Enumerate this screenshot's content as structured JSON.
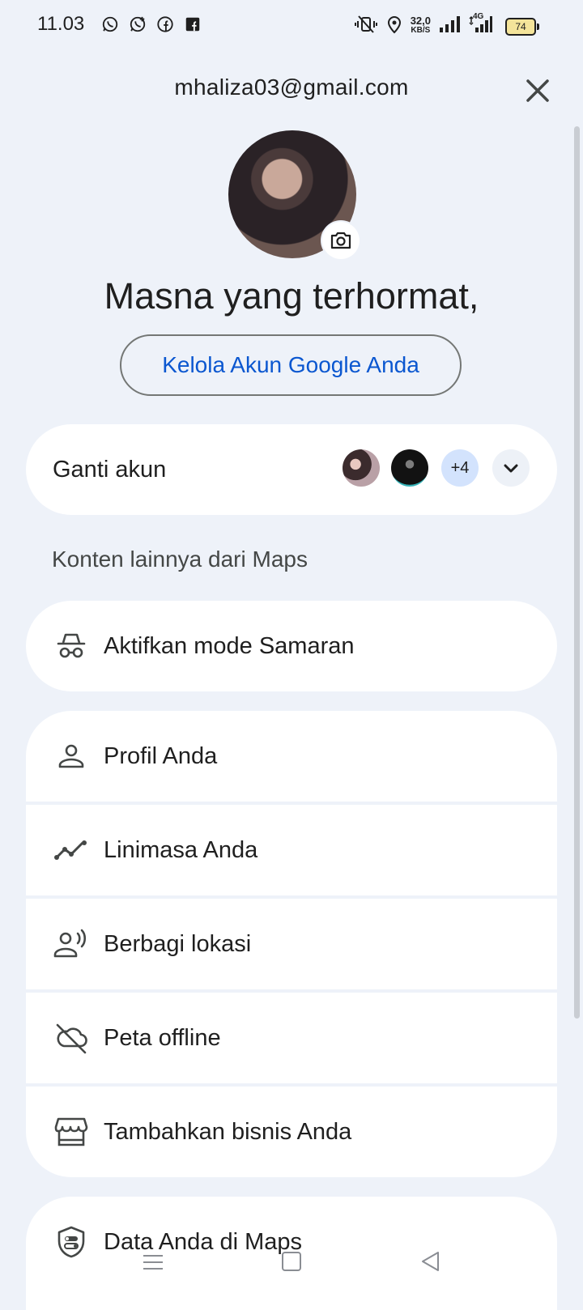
{
  "status_bar": {
    "time": "11.03",
    "speed_value": "32,0",
    "speed_unit": "KB/S",
    "network": "4G",
    "battery": "74"
  },
  "header": {
    "email": "mhaliza03@gmail.com"
  },
  "profile": {
    "greeting": "Masna yang terhormat,",
    "manage_button": "Kelola Akun Google Anda"
  },
  "switch_account": {
    "label": "Ganti akun",
    "more_count": "+4"
  },
  "section": {
    "title": "Konten lainnya dari Maps"
  },
  "incognito": {
    "label": "Aktifkan mode Samaran"
  },
  "menu": [
    {
      "label": "Profil Anda",
      "icon": "person-icon"
    },
    {
      "label": "Linimasa Anda",
      "icon": "timeline-icon"
    },
    {
      "label": "Berbagi lokasi",
      "icon": "location-sharing-icon"
    },
    {
      "label": "Peta offline",
      "icon": "offline-maps-icon"
    },
    {
      "label": "Tambahkan bisnis Anda",
      "icon": "storefront-icon"
    }
  ],
  "menu2": [
    {
      "label": "Data Anda di Maps",
      "icon": "shield-data-icon"
    }
  ],
  "colors": {
    "background": "#eef2f9",
    "accent": "#0b57d0",
    "card": "#ffffff"
  }
}
